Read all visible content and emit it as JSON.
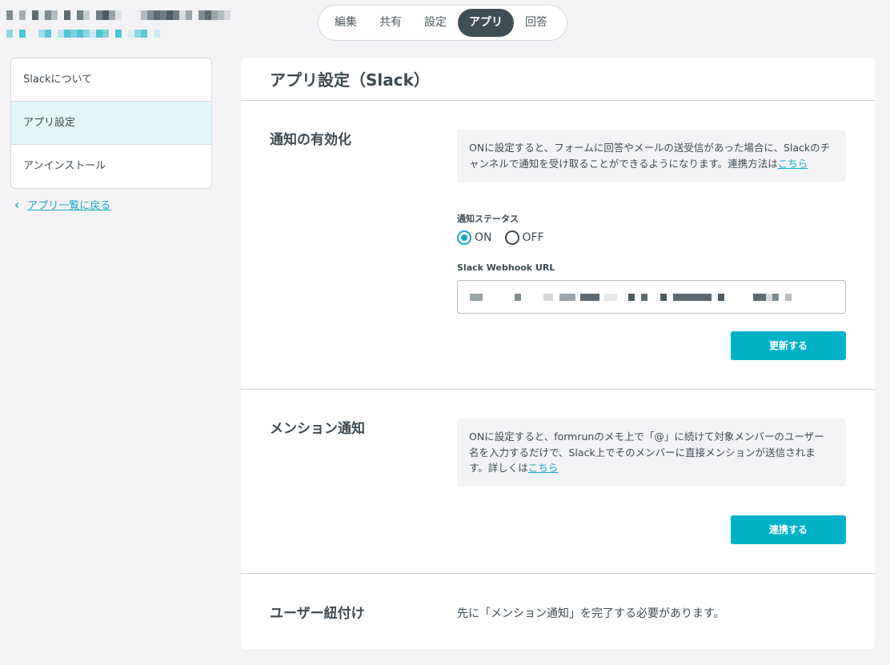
{
  "header": {
    "tabs": [
      {
        "label": "編集"
      },
      {
        "label": "共有"
      },
      {
        "label": "設定"
      },
      {
        "label": "アプリ"
      },
      {
        "label": "回答"
      }
    ],
    "active_tab": "アプリ"
  },
  "sidebar": {
    "items": [
      {
        "label": "Slackについて"
      },
      {
        "label": "アプリ設定"
      },
      {
        "label": "アンインストール"
      }
    ],
    "active_item": "アプリ設定",
    "back_link": "アプリ一覧に戻る"
  },
  "main": {
    "title": "アプリ設定（Slack）",
    "sections": [
      {
        "title": "通知の有効化",
        "description": "ONに設定すると、フォームに回答やメールの送受信があった場合に、Slackのチャンネルで通知を受け取ることができるようになります。連携方法は",
        "link": "こちら",
        "status_label": "通知ステータス",
        "radio_on": "ON",
        "radio_off": "OFF",
        "status_value": "ON",
        "webhook_label": "Slack Webhook URL",
        "button": "更新する"
      },
      {
        "title": "メンション通知",
        "description": "ONに設定すると、formrunのメモ上で「@」に続けて対象メンバーのユーザー名を入力するだけで、Slack上でそのメンバーに直接メンションが送信されます。詳しくは",
        "link": "こちら",
        "button": "連携する"
      },
      {
        "title": "ユーザー紐付け",
        "note": "先に「メンション通知」を完了する必要があります。"
      }
    ]
  },
  "colors": {
    "accent": "#00b2c8",
    "active_tab_bg": "#3e4e57",
    "sidebar_active_bg": "#e2f5f8",
    "page_bg": "#f3f3f6"
  }
}
